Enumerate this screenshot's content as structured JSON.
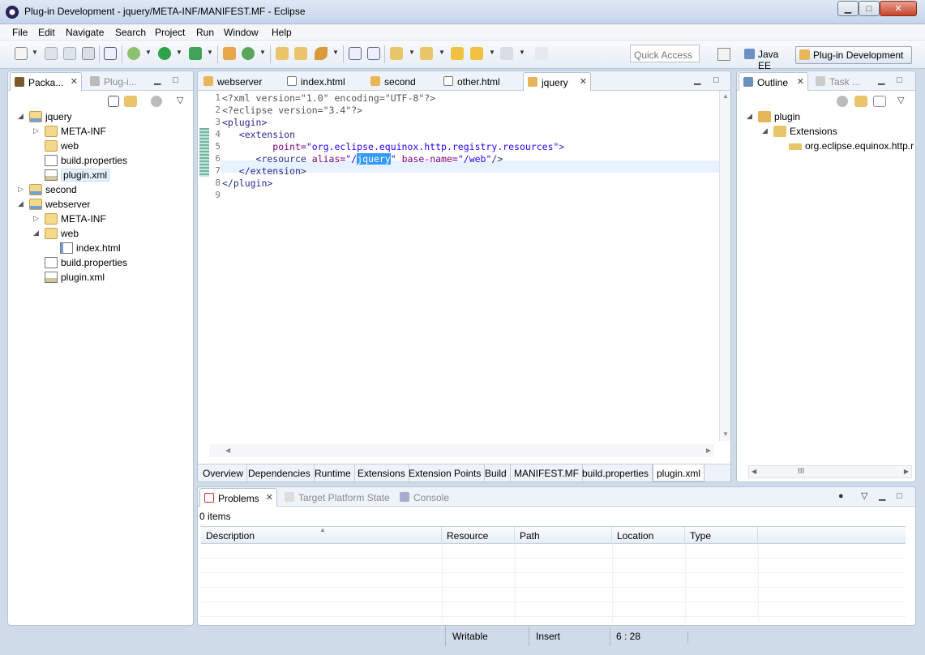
{
  "window": {
    "title": "Plug-in Development - jquery/META-INF/MANIFEST.MF - Eclipse",
    "min_glyph": "▁",
    "max_glyph": "□",
    "close_glyph": "✕"
  },
  "menu": [
    "File",
    "Edit",
    "Navigate",
    "Search",
    "Project",
    "Run",
    "Window",
    "Help"
  ],
  "toolbar": {
    "quick_access_placeholder": "Quick Access",
    "perspectives": [
      "Java EE",
      "Plug-in Development"
    ]
  },
  "package_explorer": {
    "tabs": [
      "Packa...",
      "Plug-i..."
    ],
    "tree": [
      {
        "label": "jquery",
        "type": "project",
        "depth": 0,
        "expanded": true
      },
      {
        "label": "META-INF",
        "type": "folder",
        "depth": 1,
        "expanded": false
      },
      {
        "label": "web",
        "type": "folder",
        "depth": 1,
        "expanded": null
      },
      {
        "label": "build.properties",
        "type": "props",
        "depth": 1,
        "expanded": null
      },
      {
        "label": "plugin.xml",
        "type": "xml",
        "depth": 1,
        "expanded": null,
        "selected": true
      },
      {
        "label": "second",
        "type": "project",
        "depth": 0,
        "expanded": false
      },
      {
        "label": "webserver",
        "type": "project",
        "depth": 0,
        "expanded": true
      },
      {
        "label": "META-INF",
        "type": "folder",
        "depth": 1,
        "expanded": false
      },
      {
        "label": "web",
        "type": "folder",
        "depth": 1,
        "expanded": true
      },
      {
        "label": "index.html",
        "type": "html",
        "depth": 2,
        "expanded": null
      },
      {
        "label": "build.properties",
        "type": "props",
        "depth": 1,
        "expanded": null
      },
      {
        "label": "plugin.xml",
        "type": "xml",
        "depth": 1,
        "expanded": null
      }
    ]
  },
  "editor": {
    "tabs": [
      "webserver",
      "index.html",
      "second",
      "other.html",
      "jquery"
    ],
    "active_tab": "jquery",
    "line_numbers": [
      "1",
      "2",
      "3",
      "4",
      "5",
      "6",
      "7",
      "8",
      "9"
    ],
    "code_lines": {
      "l1": "<?xml version=\"1.0\" encoding=\"UTF-8\"?>",
      "l2": "<?eclipse version=\"3.4\"?>",
      "l3": "<plugin>",
      "l4": "   <extension",
      "l5a": "         point=",
      "l5b": "\"org.eclipse.equinox.http.registry.resources\"",
      "l5c": ">",
      "l6a": "      <resource ",
      "l6b": "alias=",
      "l6c": "\"/",
      "l6sel": "jquery",
      "l6d": "\"",
      "l6e": " base-name=",
      "l6f": "\"/web\"",
      "l6g": "/>",
      "l7": "   </extension>",
      "l8": "</plugin>"
    },
    "bottom_tabs": [
      "Overview",
      "Dependencies",
      "Runtime",
      "Extensions",
      "Extension Points",
      "Build",
      "MANIFEST.MF",
      "build.properties",
      "plugin.xml"
    ],
    "active_bottom_tab": "plugin.xml",
    "cursor": "6 : 28"
  },
  "outline": {
    "tabs": [
      "Outline",
      "Task ..."
    ],
    "tree": [
      "plugin",
      "Extensions",
      "org.eclipse.equinox.http.r"
    ],
    "scroll_glyph": "III"
  },
  "problems": {
    "tabs": [
      "Problems",
      "Target Platform State",
      "Console"
    ],
    "summary": "0 items",
    "columns": [
      "Description",
      "Resource",
      "Path",
      "Location",
      "Type"
    ]
  },
  "status": {
    "writable": "Writable",
    "insert": "Insert",
    "position": "6 : 28"
  },
  "colors": {
    "accent": "#3399ff",
    "panel_border": "#b6c3d3",
    "background": "#cfdbe9"
  }
}
